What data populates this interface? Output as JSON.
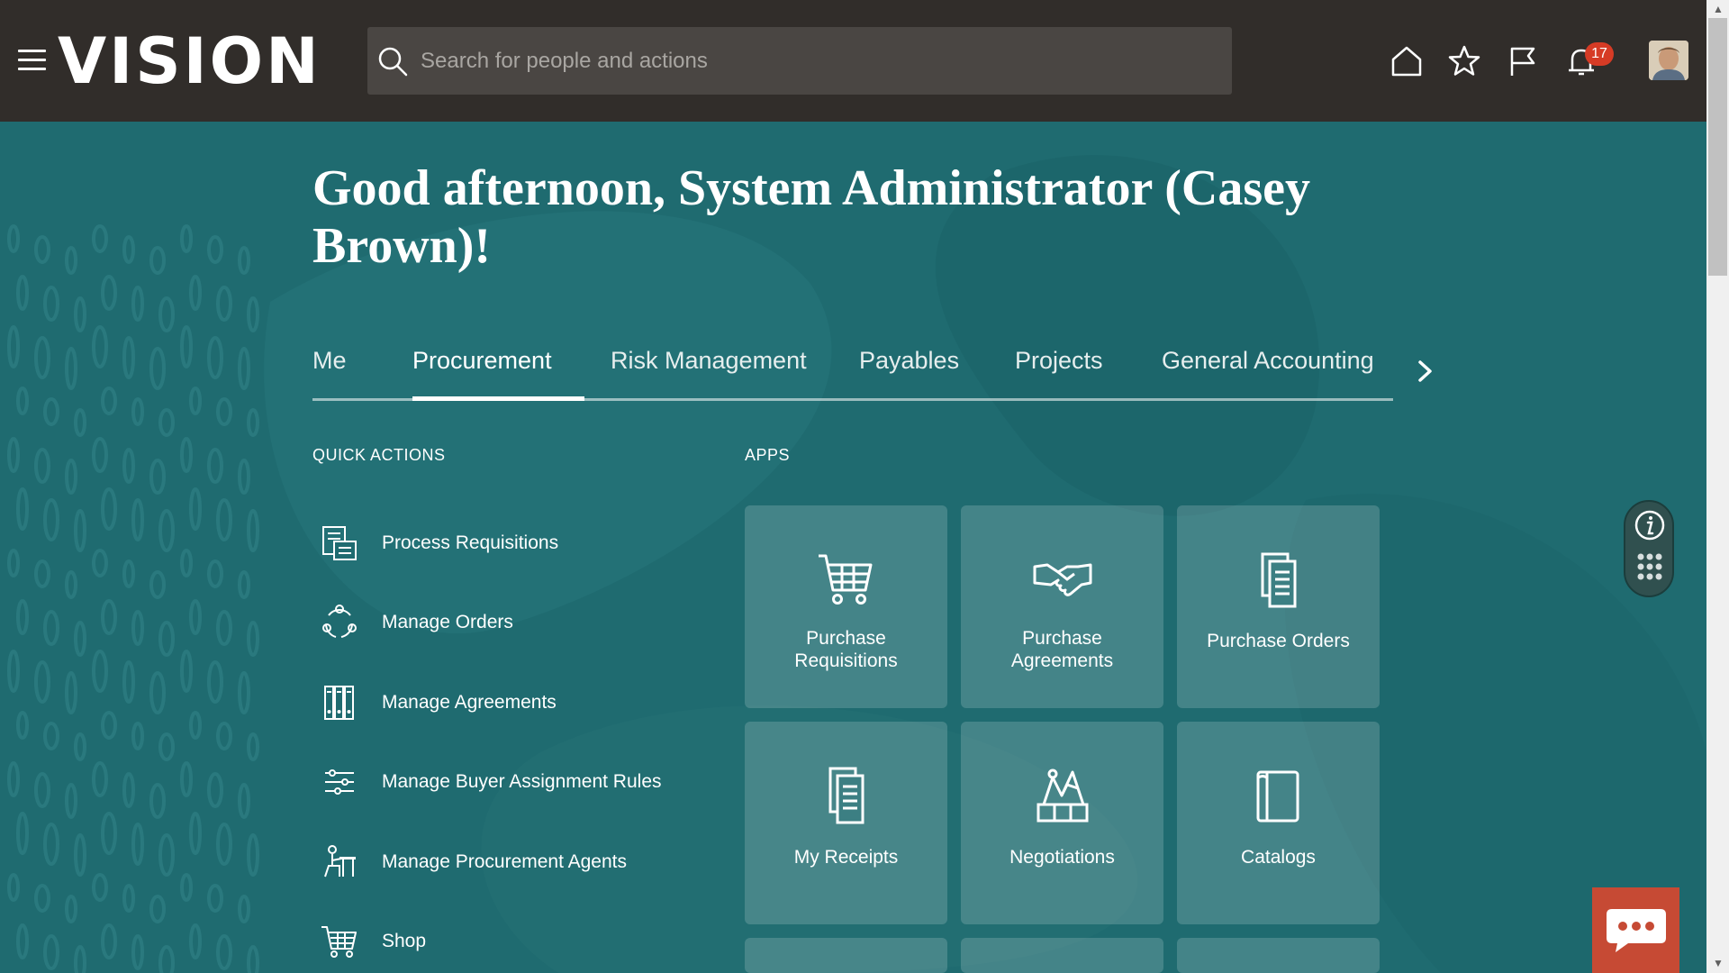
{
  "header": {
    "logo_text": "VISION",
    "search_placeholder": "Search for people and actions",
    "notification_count": "17",
    "icons": [
      "menu-icon",
      "search-icon",
      "home-icon",
      "favorites-star-icon",
      "flag-icon",
      "bell-icon"
    ]
  },
  "greeting": "Good afternoon, System Administrator (Casey Brown)!",
  "tabs": [
    {
      "label": "Me",
      "active": false
    },
    {
      "label": "Procurement",
      "active": true
    },
    {
      "label": "Risk Management",
      "active": false
    },
    {
      "label": "Payables",
      "active": false
    },
    {
      "label": "Projects",
      "active": false
    },
    {
      "label": "General Accounting",
      "active": false
    }
  ],
  "quick_actions": {
    "title": "QUICK ACTIONS",
    "items": [
      {
        "label": "Process Requisitions",
        "icon": "requisition-icon"
      },
      {
        "label": "Manage Orders",
        "icon": "orders-cycle-icon"
      },
      {
        "label": "Manage Agreements",
        "icon": "agreements-binders-icon"
      },
      {
        "label": "Manage Buyer Assignment Rules",
        "icon": "rules-icon"
      },
      {
        "label": "Manage Procurement Agents",
        "icon": "agent-icon"
      },
      {
        "label": "Shop",
        "icon": "cart-icon"
      }
    ]
  },
  "apps": {
    "title": "APPS",
    "tiles": [
      {
        "label": "Purchase Requisitions",
        "icon": "cart-icon"
      },
      {
        "label": "Purchase Agreements",
        "icon": "handshake-icon"
      },
      {
        "label": "Purchase Orders",
        "icon": "document-stack-icon"
      },
      {
        "label": "My Receipts",
        "icon": "receipt-icon"
      },
      {
        "label": "Negotiations",
        "icon": "negotiations-icon"
      },
      {
        "label": "Catalogs",
        "icon": "catalog-icon"
      }
    ]
  },
  "colors": {
    "header_bg": "#312d2a",
    "page_bg": "#1f6b70",
    "badge": "#d63b25",
    "chat_button": "#c64a34"
  }
}
